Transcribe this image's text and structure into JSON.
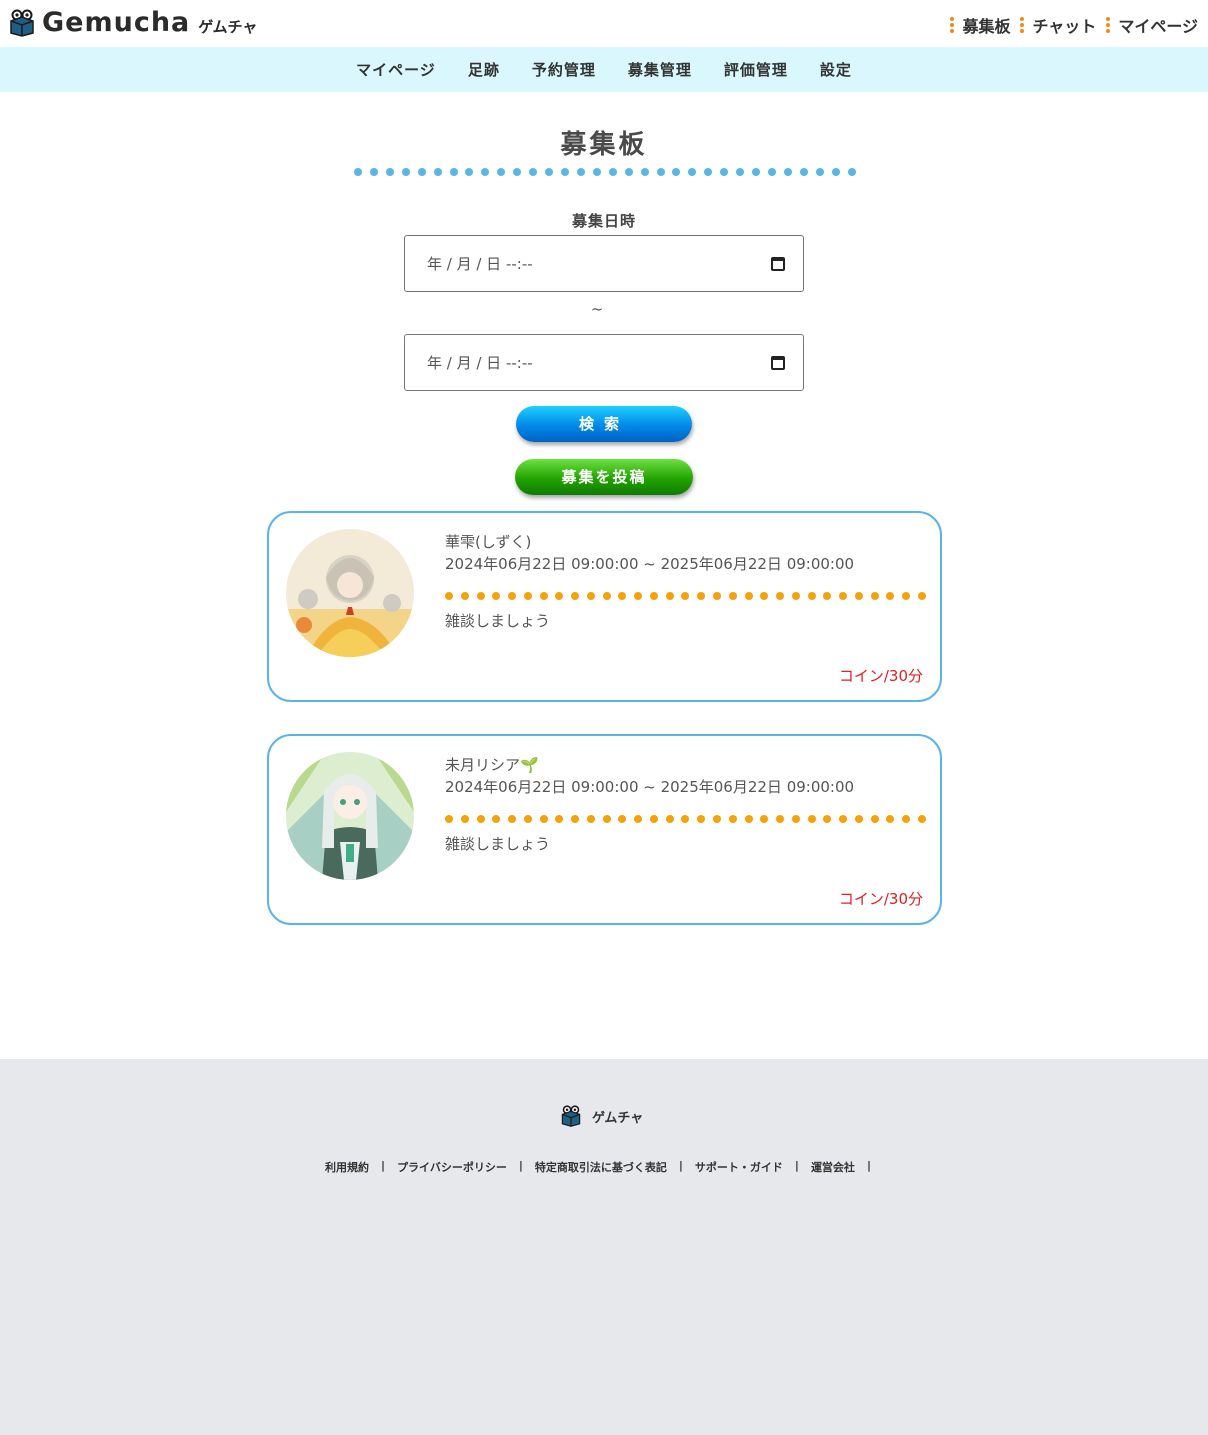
{
  "header": {
    "logo_text": "Gemucha",
    "logo_sub": "ゲムチャ",
    "nav": [
      {
        "label": "募集板"
      },
      {
        "label": "チャット"
      },
      {
        "label": "マイページ"
      }
    ]
  },
  "subnav": {
    "items": [
      "マイページ",
      "足跡",
      "予約管理",
      "募集管理",
      "評価管理",
      "設定"
    ]
  },
  "main": {
    "title": "募集板",
    "field_label": "募集日時",
    "date_from_placeholder": "年 / 月 / 日  --:--",
    "range_separator": "~",
    "date_to_placeholder": "年 / 月 / 日  --:--",
    "search_button": "検索",
    "post_button": "募集を投稿"
  },
  "posts": [
    {
      "name": "華雫(しずく)",
      "period": "2024年06月22日 09:00:00 ~ 2025年06月22日 09:00:00",
      "message": "雑談しましょう",
      "price": "コイン/30分"
    },
    {
      "name": "未月リシア🌱",
      "period": "2024年06月22日 09:00:00 ~ 2025年06月22日 09:00:00",
      "message": "雑談しましょう",
      "price": "コイン/30分"
    }
  ],
  "footer": {
    "logo_text": "ゲムチャ",
    "links": [
      "利用規約",
      "プライバシーポリシー",
      "特定商取引法に基づく表記",
      "サポート・ガイド",
      "運営会社"
    ],
    "separator": "|"
  },
  "colors": {
    "subnav_bg": "#d9f7fd",
    "accent_blue": "#5ab4ea",
    "accent_orange": "#f5a20a",
    "price_red": "#e02020",
    "footer_bg": "#e7e8eb"
  }
}
